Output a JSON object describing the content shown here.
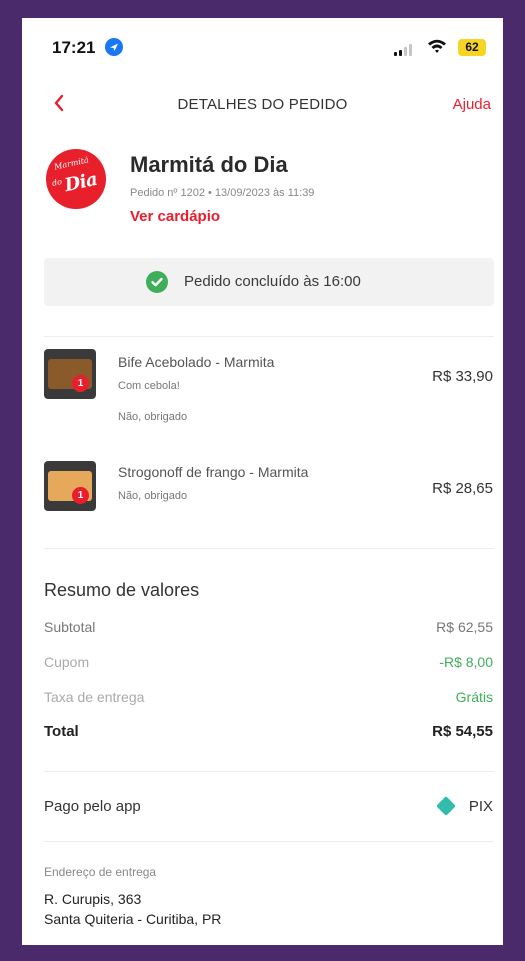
{
  "status_bar": {
    "time": "17:21",
    "battery": "62"
  },
  "header": {
    "title": "DETALHES DO PEDIDO",
    "help": "Ajuda",
    "back_icon": "chevron-left-icon",
    "accent": "#ea1d2c"
  },
  "restaurant": {
    "logo_small_top": "Marmitá",
    "logo_small_left": "do",
    "logo_main": "Dia",
    "name": "Marmitá do Dia",
    "order_meta": "Pedido nº 1202 • 13/09/2023 às 11:39",
    "menu_link": "Ver cardápio"
  },
  "order_status": {
    "text": "Pedido concluído às 16:00",
    "icon": "check-circle-icon",
    "color": "#3fae5a"
  },
  "items": [
    {
      "name": "Bife Acebolado - Marmita",
      "details": [
        "Com cebola!",
        "Não, obrigado"
      ],
      "price": "R$ 33,90",
      "quantity": "1"
    },
    {
      "name": "Strogonoff de frango - Marmita",
      "details": [
        "Não, obrigado"
      ],
      "price": "R$ 28,65",
      "quantity": "1"
    }
  ],
  "summary": {
    "title": "Resumo de valores",
    "rows": [
      {
        "label": "Subtotal",
        "value": "R$ 62,55"
      },
      {
        "label": "Cupom",
        "value": "-R$ 8,00"
      },
      {
        "label": "Taxa de entrega",
        "value": "Grátis"
      },
      {
        "label": "Total",
        "value": "R$ 54,55"
      }
    ]
  },
  "payment": {
    "label": "Pago pelo app",
    "method": "PIX",
    "icon": "pix-icon"
  },
  "address": {
    "label": "Endereço de entrega",
    "line1": "R. Curupis, 363",
    "line2": "Santa Quiteria - Curitiba, PR"
  }
}
